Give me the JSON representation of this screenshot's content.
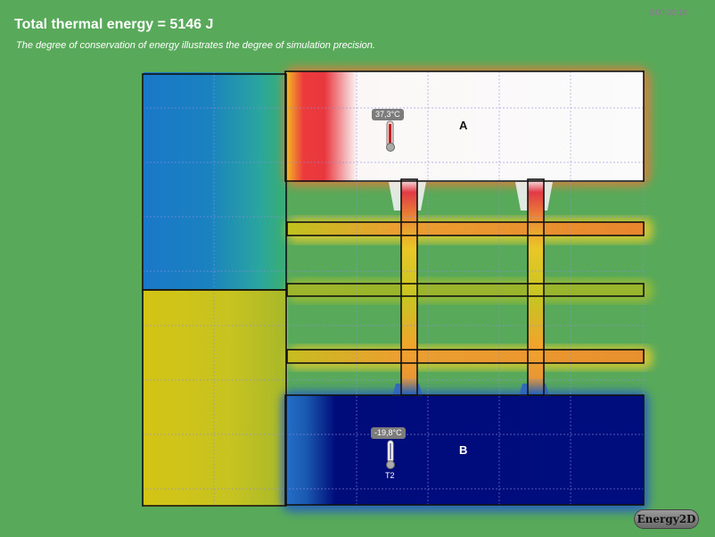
{
  "header": {
    "title": "Total thermal energy = 5146 J",
    "subtitle": "The degree of conservation of energy illustrates the degree of simulation precision.",
    "clock": "0:00:00:14"
  },
  "parts": {
    "a_label": "A",
    "b_label": "B"
  },
  "thermometers": [
    {
      "reading": "37,3°C",
      "name": ""
    },
    {
      "reading": "-19,8°C",
      "name": "T2"
    }
  ],
  "branding": {
    "logo_text": "Energy2D"
  },
  "colors": {
    "background": "#58a95a",
    "hot": "#ffffff",
    "warm": "#e8913a",
    "cold": "#000d7d",
    "grid": "#8e8ede"
  }
}
